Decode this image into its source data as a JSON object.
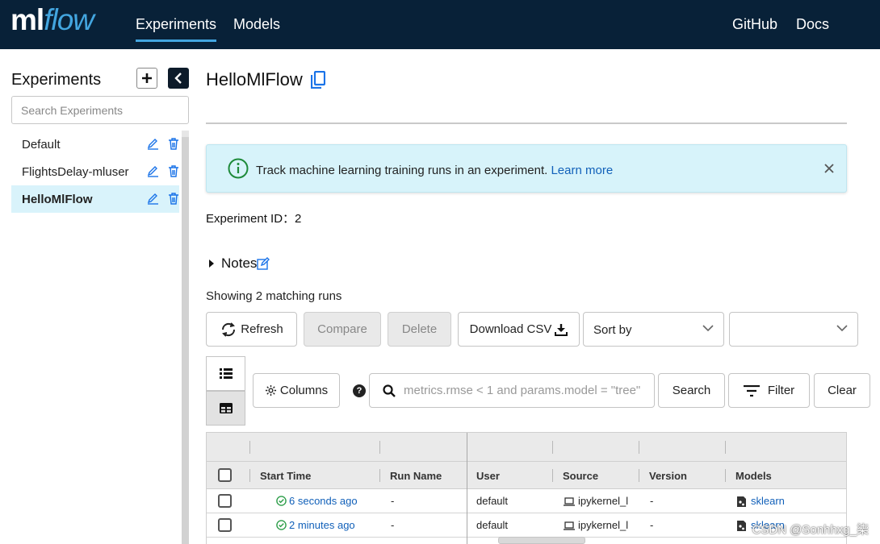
{
  "topbar": {
    "logo_ml": "ml",
    "logo_flow": "flow",
    "nav": [
      {
        "label": "Experiments",
        "active": true
      },
      {
        "label": "Models",
        "active": false
      }
    ],
    "right_links": [
      "GitHub",
      "Docs"
    ]
  },
  "sidebar": {
    "title": "Experiments",
    "search_placeholder": "Search Experiments",
    "items": [
      {
        "label": "Default",
        "active": false
      },
      {
        "label": "FlightsDelay-mluser",
        "active": false
      },
      {
        "label": "HelloMlFlow",
        "active": true
      }
    ]
  },
  "main": {
    "title": "HelloMlFlow",
    "banner": {
      "text": "Track machine learning training runs in an experiment.",
      "link": "Learn more"
    },
    "experiment_id_label": "Experiment ID：",
    "experiment_id": "2",
    "notes_label": "Notes",
    "showing_text": "Showing 2 matching runs",
    "buttons": {
      "refresh": "Refresh",
      "compare": "Compare",
      "delete": "Delete",
      "download": "Download CSV",
      "sort_by": "Sort by",
      "columns": "Columns",
      "search": "Search",
      "filter": "Filter",
      "clear": "Clear"
    },
    "search_placeholder": "metrics.rmse < 1 and params.model = \"tree\"",
    "table": {
      "headers": [
        "Start Time",
        "Run Name",
        "User",
        "Source",
        "Version",
        "Models"
      ],
      "rows": [
        {
          "start_time": "6 seconds ago",
          "run_name": "-",
          "user": "default",
          "source": "ipykernel_l",
          "version": "-",
          "models": "sklearn"
        },
        {
          "start_time": "2 minutes ago",
          "run_name": "-",
          "user": "default",
          "source": "ipykernel_l",
          "version": "-",
          "models": "sklearn"
        }
      ]
    }
  },
  "watermark": "CSDN @Sonhhxg_柒",
  "colors": {
    "topbar_bg": "#082138",
    "accent": "#43a6e0",
    "link": "#1160b9",
    "success": "#2e9e4a",
    "banner_bg": "#d7f3fa",
    "selected_item_bg": "#d9f3fb"
  }
}
